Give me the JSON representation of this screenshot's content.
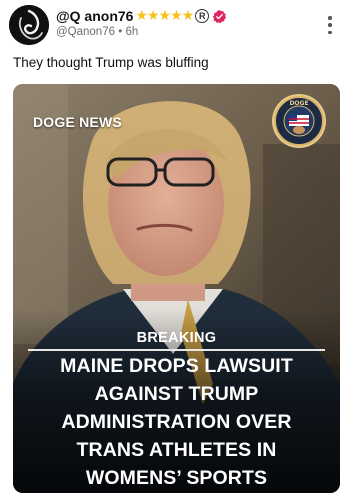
{
  "post": {
    "display_name": "@Q anon76",
    "stars": "★★★★★",
    "registered_mark": "R",
    "handle": "@Qanon76",
    "separator": "•",
    "time_ago": "6h",
    "text": "They thought Trump was bluffing"
  },
  "media": {
    "brand": "DOGE NEWS",
    "seal_text": "DOGE",
    "kicker": "BREAKING",
    "headline_lines": [
      "MAINE DROPS LAWSUIT",
      "AGAINST TRUMP",
      "ADMINISTRATION OVER",
      "TRANS ATHLETES IN",
      "WOMENS’ SPORTS"
    ]
  },
  "icons": {
    "verified": "verified-badge-icon",
    "more": "more-vertical-icon",
    "seal": "doge-seal-icon"
  },
  "colors": {
    "star": "#f7c21c",
    "verified": "#e0245e",
    "meta_text": "#6b6f75"
  }
}
